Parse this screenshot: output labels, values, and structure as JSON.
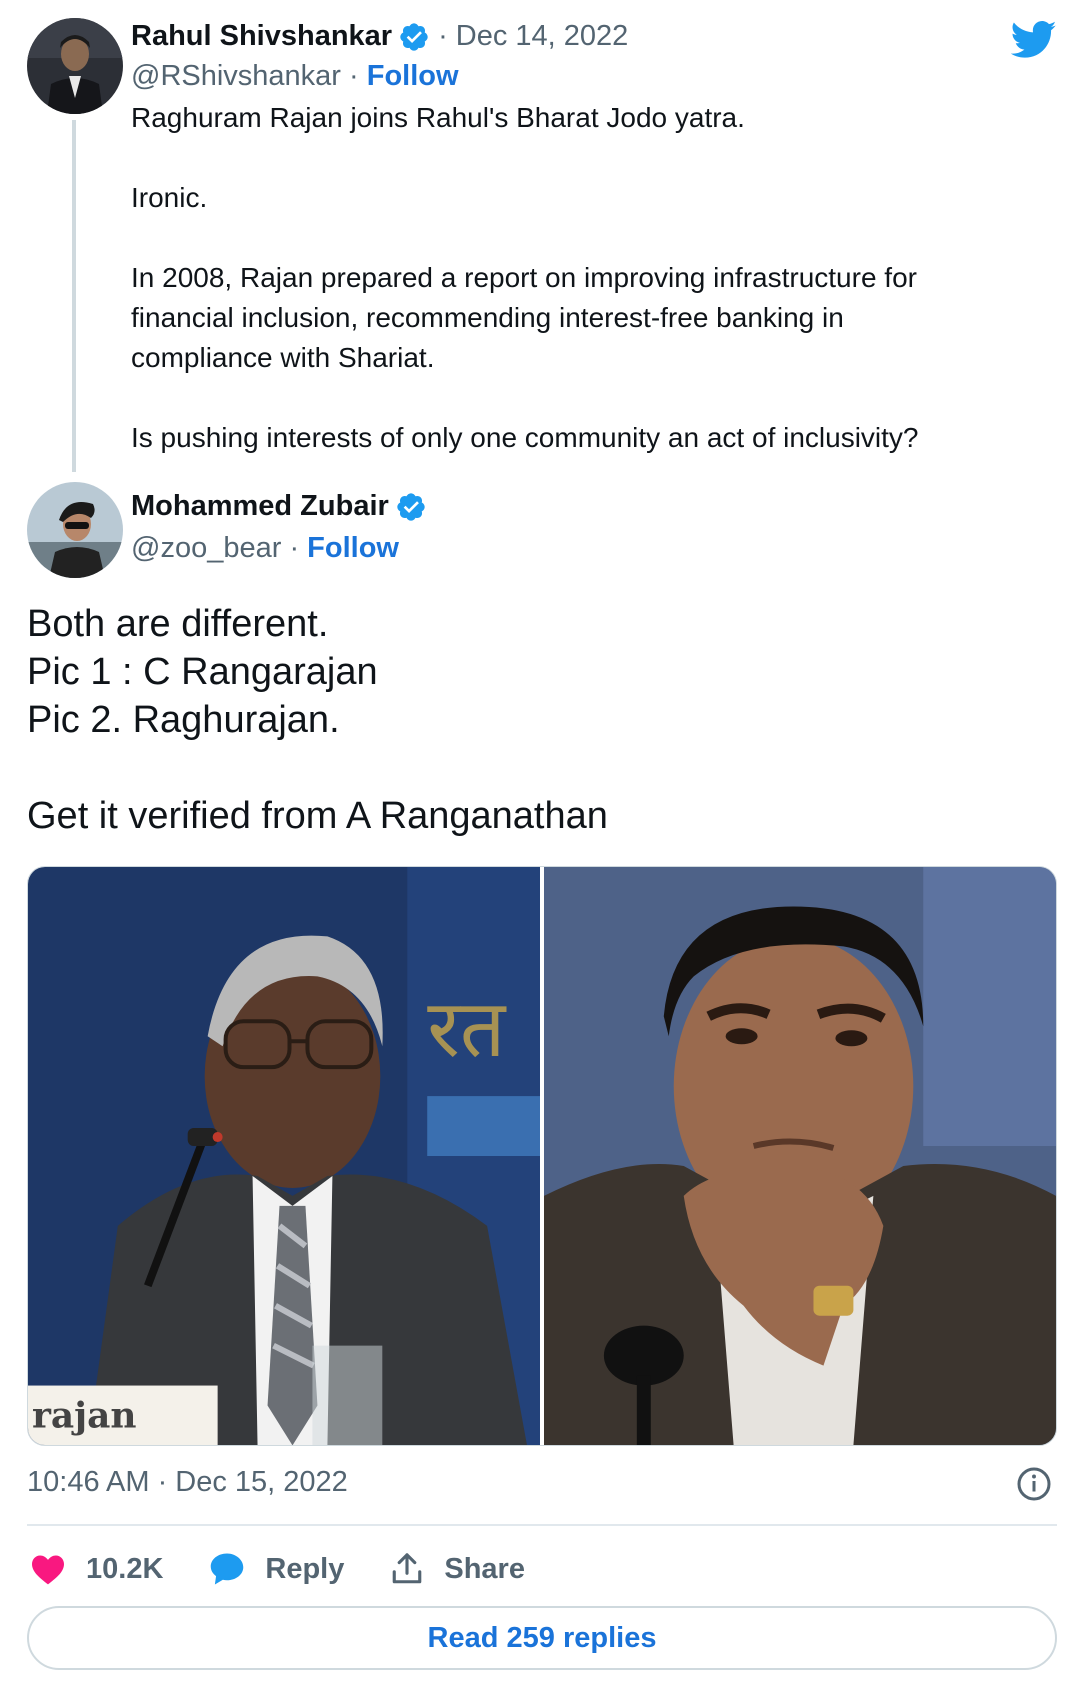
{
  "quoted_tweet": {
    "author_name": "Rahul Shivshankar",
    "separator": "·",
    "date": "Dec 14, 2022",
    "handle": "@RShivshankar",
    "follow_label": "Follow",
    "lines": {
      "l1": "Raghuram Rajan joins Rahul's Bharat Jodo yatra.",
      "l2": "Ironic.",
      "l3": "In 2008, Rajan prepared a report on improving infrastructure for",
      "l4": "financial inclusion, recommending interest-free banking in",
      "l5": "compliance with Shariat.",
      "l6": "Is pushing interests of only one community an act of inclusivity?"
    }
  },
  "tweet": {
    "author_name": "Mohammed Zubair",
    "handle": "@zoo_bear",
    "follow_label": "Follow",
    "lines": {
      "l1": "Both are different.",
      "l2": "Pic 1 : C Rangarajan",
      "l3": "Pic 2. Raghurajan.",
      "l4": "Get it verified from A Ranganathan"
    },
    "photo1_caption": "rajan",
    "timestamp": "10:46 AM · Dec 15, 2022"
  },
  "actions": {
    "like_count": "10.2K",
    "reply_label": "Reply",
    "share_label": "Share"
  },
  "read_replies_label": "Read 259 replies",
  "colors": {
    "accent": "#1d9bf0",
    "link": "#1a73d9",
    "like": "#f91880",
    "secondary_text": "#536471"
  },
  "icons": [
    "verified-badge-icon",
    "twitter-bird-icon",
    "info-icon",
    "heart-icon",
    "reply-bubble-icon",
    "share-icon"
  ]
}
